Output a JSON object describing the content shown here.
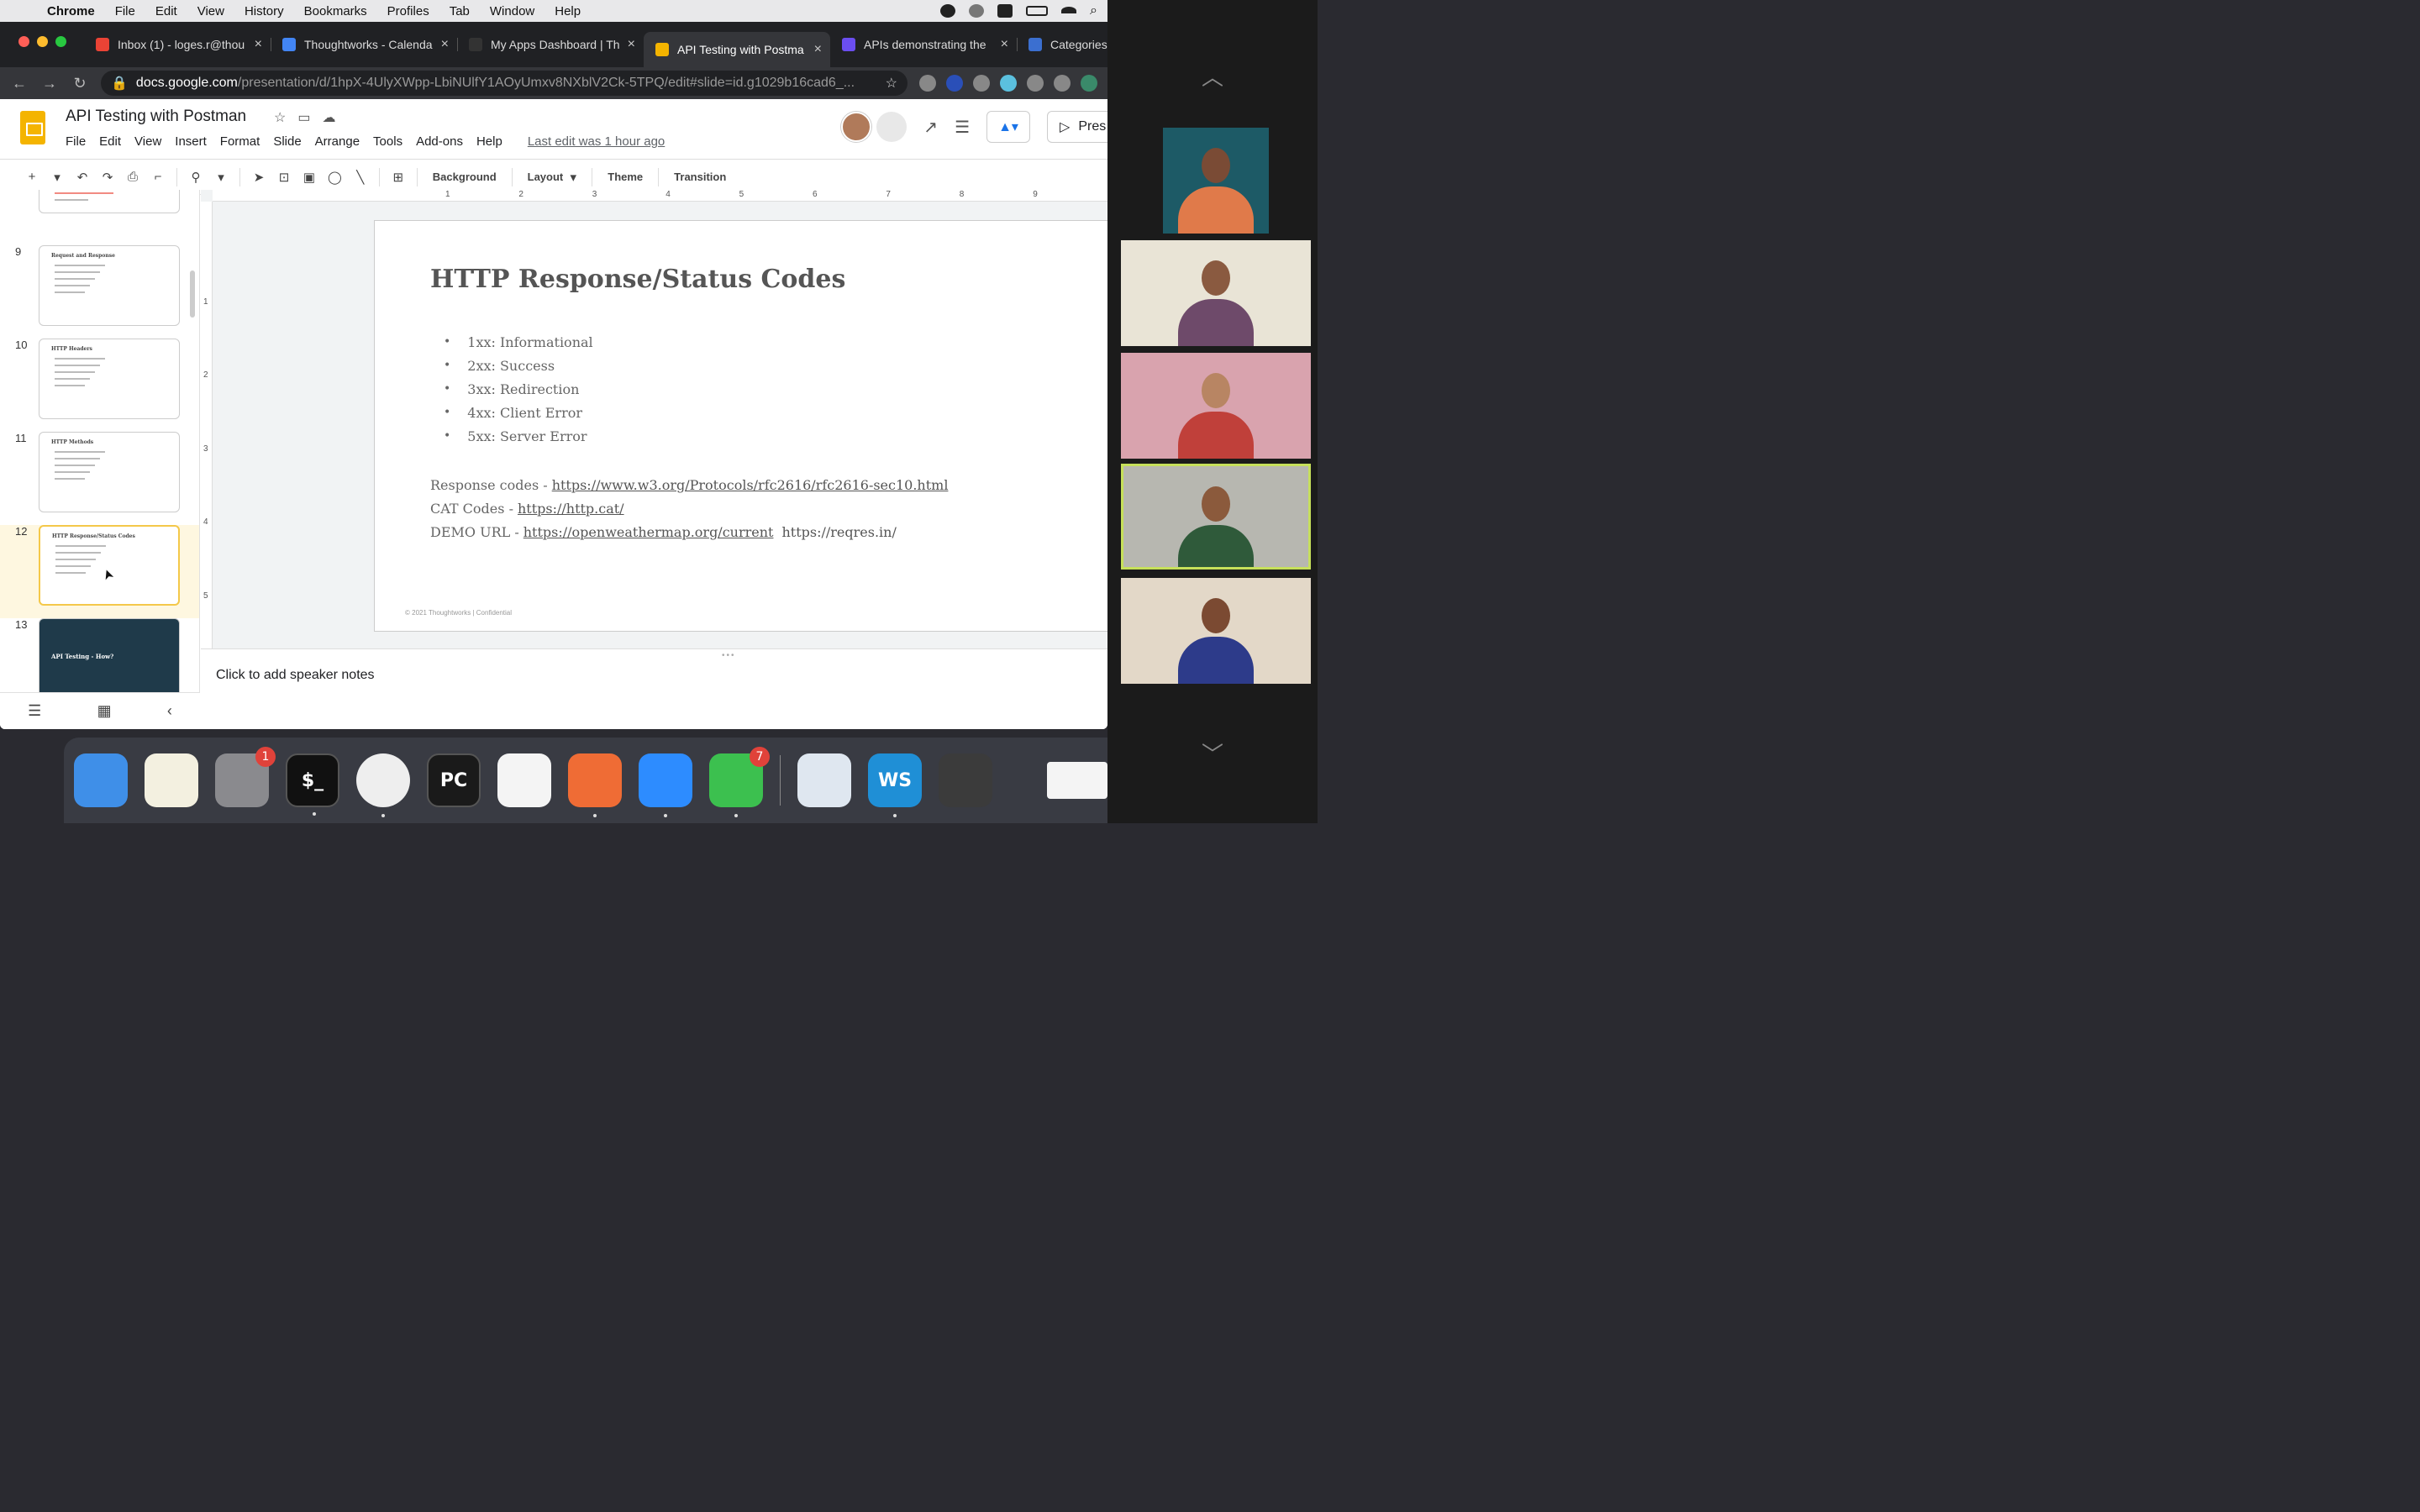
{
  "menubar": {
    "app": "Chrome",
    "items": [
      "File",
      "Edit",
      "View",
      "History",
      "Bookmarks",
      "Profiles",
      "Tab",
      "Window",
      "Help"
    ]
  },
  "browser": {
    "tabs": [
      {
        "label": "Inbox (1) - loges.r@thou",
        "favicon_color": "#ea4335"
      },
      {
        "label": "Thoughtworks - Calenda",
        "favicon_color": "#4285f4"
      },
      {
        "label": "My Apps Dashboard | Th",
        "favicon_color": "#333333"
      },
      {
        "label": "API Testing with Postma",
        "favicon_color": "#f4b400"
      },
      {
        "label": "APIs demonstrating the",
        "favicon_color": "#6b4ef0"
      },
      {
        "label": "Categories",
        "favicon_color": "#3b6fd0"
      }
    ],
    "active_tab": 3,
    "url_host": "docs.google.com",
    "url_path": "/presentation/d/1hpX-4UlyXWpp-LbiNUlfY1AOyUmxv8NXblV2Ck-5TPQ/edit#slide=id.g1029b16cad6_..."
  },
  "slides_app": {
    "doc_title": "API Testing with Postman",
    "menu": [
      "File",
      "Edit",
      "View",
      "Insert",
      "Format",
      "Slide",
      "Arrange",
      "Tools",
      "Add-ons",
      "Help"
    ],
    "last_edit": "Last edit was 1 hour ago",
    "present_label": "Pres",
    "toolbar_buttons": [
      "Background",
      "Layout",
      "Theme",
      "Transition"
    ]
  },
  "filmstrip": {
    "thumbs": [
      {
        "number": "9",
        "title": "Request and Response"
      },
      {
        "number": "10",
        "title": "HTTP Headers"
      },
      {
        "number": "11",
        "title": "HTTP Methods"
      },
      {
        "number": "12",
        "title": "HTTP Response/Status Codes"
      },
      {
        "number": "13",
        "title": "API Testing - How?"
      }
    ],
    "selected_index": 3
  },
  "ruler": {
    "h_numbers": [
      "1",
      "2",
      "3",
      "4",
      "5",
      "6",
      "7",
      "8",
      "9"
    ],
    "v_numbers": [
      "1",
      "2",
      "3",
      "4",
      "5"
    ]
  },
  "slide": {
    "title": "HTTP Response/Status Codes",
    "bullets": [
      "1xx: Informational",
      "2xx: Success",
      "3xx: Redirection",
      "4xx: Client Error",
      "5xx: Server Error"
    ],
    "links": [
      {
        "label": "Response codes -",
        "url": "https://www.w3.org/Protocols/rfc2616/rfc2616-sec10.html",
        "extra": ""
      },
      {
        "label": "CAT Codes -",
        "url": "https://http.cat/",
        "extra": ""
      },
      {
        "label": "DEMO URL -",
        "url": "https://openweathermap.org/current",
        "extra": "https://reqres.in/"
      }
    ],
    "footer": "© 2021 Thoughtworks  |  Confidential"
  },
  "notes": {
    "placeholder": "Click to add speaker notes"
  },
  "dock": {
    "apps": [
      {
        "name": "finder",
        "label": "",
        "color": "#3f8fe8",
        "badge": ""
      },
      {
        "name": "notes",
        "label": "",
        "color": "#f3f0e0",
        "badge": ""
      },
      {
        "name": "system-preferences",
        "label": "",
        "color": "#8a8a8e",
        "badge": "1"
      },
      {
        "name": "terminal",
        "label": "$_",
        "color": "#111111",
        "badge": ""
      },
      {
        "name": "chrome",
        "label": "",
        "color": "#eeeeee",
        "badge": ""
      },
      {
        "name": "pycharm",
        "label": "PC",
        "color": "#1a1a1a",
        "badge": ""
      },
      {
        "name": "textedit",
        "label": "",
        "color": "#f4f4f4",
        "badge": ""
      },
      {
        "name": "postman",
        "label": "",
        "color": "#ef6c35",
        "badge": ""
      },
      {
        "name": "zoom",
        "label": "",
        "color": "#2d8cff",
        "badge": ""
      },
      {
        "name": "messages",
        "label": "",
        "color": "#3cc04f",
        "badge": "7"
      },
      {
        "name": "1password",
        "label": "",
        "color": "#dfe7f0",
        "badge": ""
      },
      {
        "name": "webstorm",
        "label": "WS",
        "color": "#1f8fd6",
        "badge": ""
      },
      {
        "name": "sublime-text",
        "label": "",
        "color": "#3b3b3b",
        "badge": ""
      }
    ]
  },
  "video_panel": {
    "participants": [
      {
        "bg": "#1d5a66",
        "skin": "#7a4b35",
        "shirt": "#e07a4a"
      },
      {
        "bg": "#e9e4d6",
        "skin": "#8a5a40",
        "shirt": "#6e4a6a"
      },
      {
        "bg": "#d9a3ae",
        "skin": "#b88563",
        "shirt": "#c0403a"
      },
      {
        "bg": "#b7b7b0",
        "skin": "#8b5a3c",
        "shirt": "#2f5a3a"
      },
      {
        "bg": "#e3d8c8",
        "skin": "#7b4a32",
        "shirt": "#2d3b8a"
      }
    ],
    "active_index": 3
  }
}
